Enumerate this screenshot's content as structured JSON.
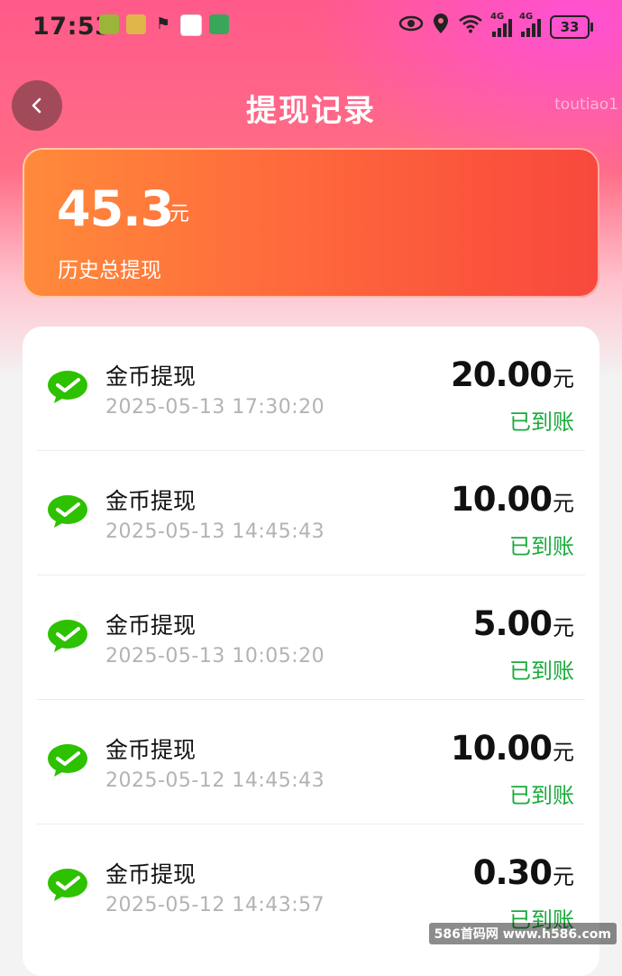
{
  "status_bar": {
    "time": "17:53",
    "battery": "33",
    "network_labels": [
      "4G",
      "4G"
    ]
  },
  "header": {
    "title": "提现记录",
    "corner_text": "toutiao1"
  },
  "summary": {
    "amount": "45.3",
    "unit": "元",
    "label": "历史总提现"
  },
  "records": [
    {
      "title": "金币提现",
      "time": "2025-05-13 17:30:20",
      "amount": "20.00",
      "unit": "元",
      "status": "已到账"
    },
    {
      "title": "金币提现",
      "time": "2025-05-13 14:45:43",
      "amount": "10.00",
      "unit": "元",
      "status": "已到账"
    },
    {
      "title": "金币提现",
      "time": "2025-05-13 10:05:20",
      "amount": "5.00",
      "unit": "元",
      "status": "已到账"
    },
    {
      "title": "金币提现",
      "time": "2025-05-12 14:45:43",
      "amount": "10.00",
      "unit": "元",
      "status": "已到账"
    },
    {
      "title": "金币提现",
      "time": "2025-05-12 14:43:57",
      "amount": "0.30",
      "unit": "元",
      "status": "已到账"
    }
  ],
  "watermark": "586首码网 www.h586.com",
  "colors": {
    "accent_green": "#1aab3b",
    "wechat_green": "#2dc100",
    "card_start": "#ff8a3a",
    "card_end": "#f8483d"
  }
}
